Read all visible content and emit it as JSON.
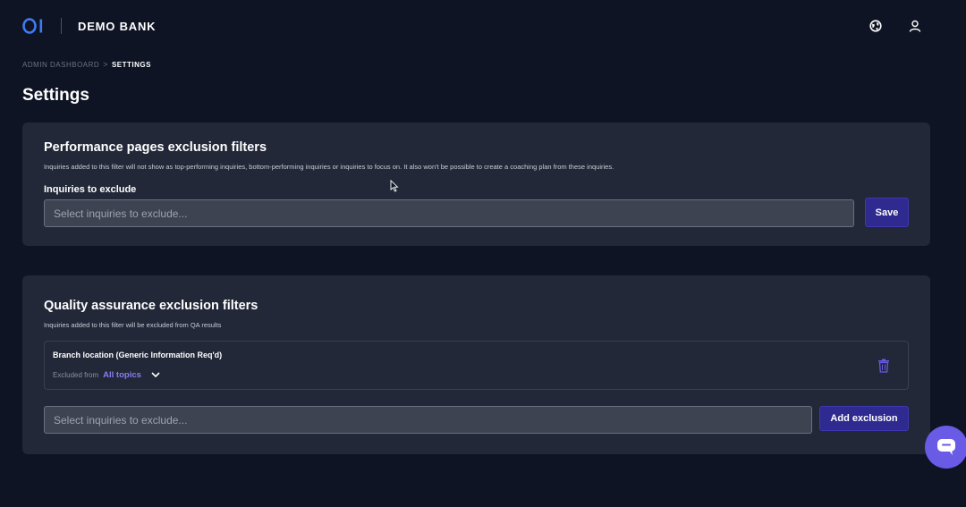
{
  "header": {
    "logo_text": "OI",
    "brand": "DEMO BANK",
    "icons": [
      "globe-icon",
      "user-icon"
    ]
  },
  "breadcrumb": {
    "parent": "ADMIN DASHBOARD",
    "separator": ">",
    "current": "SETTINGS"
  },
  "page": {
    "title": "Settings"
  },
  "performance_filters": {
    "title": "Performance pages exclusion filters",
    "description": "Inquiries added to this filter will not show as top-performing inquiries, bottom-performing inquiries or inquiries to focus on. It also won't be possible to create a coaching plan from these inquiries.",
    "field_label": "Inquiries to exclude",
    "placeholder": "Select inquiries to exclude...",
    "save_label": "Save"
  },
  "qa_filters": {
    "title": "Quality assurance exclusion filters",
    "description": "Inquiries added to this filter will be excluded from QA results",
    "items": [
      {
        "name": "Branch location (Generic Information Req'd)",
        "excluded_from_label": "Excluded from",
        "excluded_from_value": "All topics"
      }
    ],
    "placeholder": "Select inquiries to exclude...",
    "add_label": "Add exclusion"
  },
  "colors": {
    "background": "#0e1424",
    "card": "#222838",
    "accent": "#2f2a8f",
    "link": "#8b7cf0",
    "logo": "#3f7bf5",
    "fab": "#6a5be6"
  }
}
